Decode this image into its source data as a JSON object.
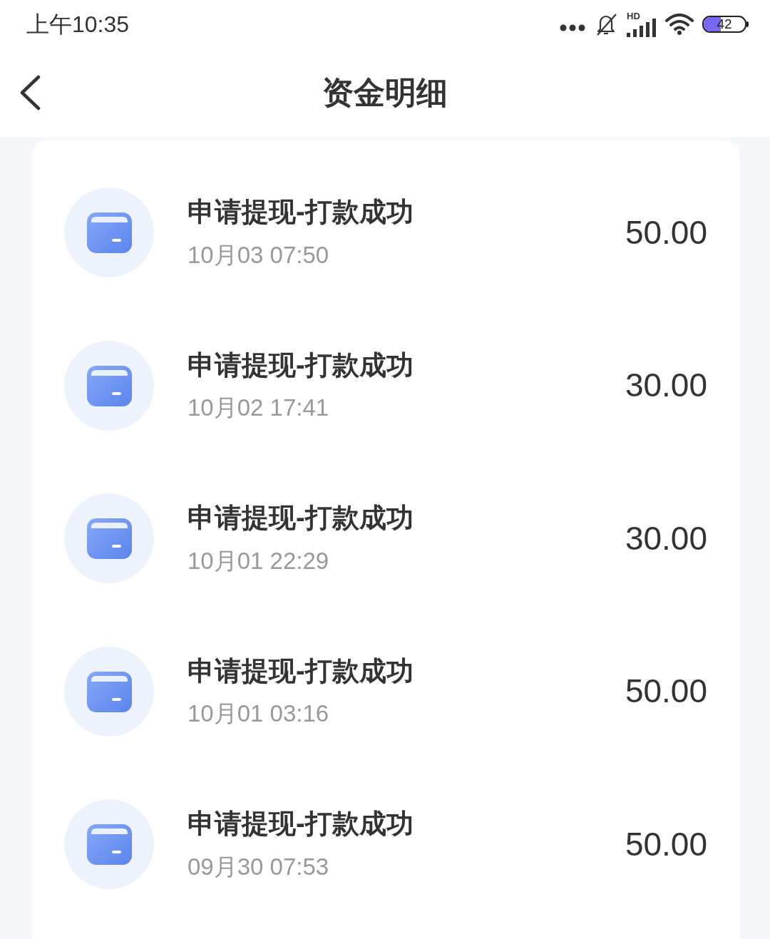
{
  "status_bar": {
    "time": "上午10:35",
    "network_label": "HD",
    "battery": "42"
  },
  "nav_bar": {
    "title": "资金明细"
  },
  "records": [
    {
      "title": "申请提现-打款成功",
      "time": "10月03 07:50",
      "amount": "50.00"
    },
    {
      "title": "申请提现-打款成功",
      "time": "10月02 17:41",
      "amount": "30.00"
    },
    {
      "title": "申请提现-打款成功",
      "time": "10月01 22:29",
      "amount": "30.00"
    },
    {
      "title": "申请提现-打款成功",
      "time": "10月01 03:16",
      "amount": "50.00"
    },
    {
      "title": "申请提现-打款成功",
      "time": "09月30 07:53",
      "amount": "50.00"
    }
  ]
}
